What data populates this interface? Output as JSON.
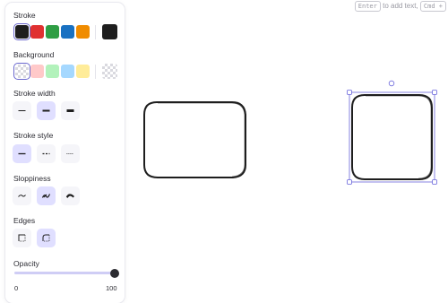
{
  "hint": {
    "enter_key": "Enter",
    "text": "to add text,",
    "cmd_key": "Cmd +"
  },
  "panel": {
    "stroke": {
      "title": "Stroke",
      "colors": [
        "#1e1e1e",
        "#e03131",
        "#2f9e44",
        "#1971c2",
        "#f08c00"
      ],
      "selected_color": "#1e1e1e",
      "current_color": "#1e1e1e"
    },
    "background": {
      "title": "Background",
      "colors": [
        "transparent",
        "#ffc9c9",
        "#b2f2bb",
        "#a5d8ff",
        "#ffec99"
      ],
      "selected_color": "transparent",
      "current_color": "transparent"
    },
    "stroke_width": {
      "title": "Stroke width",
      "options": [
        "thin",
        "bold",
        "extra-bold"
      ],
      "selected": "bold"
    },
    "stroke_style": {
      "title": "Stroke style",
      "options": [
        "solid",
        "dashed",
        "dotted"
      ],
      "selected": "solid"
    },
    "sloppiness": {
      "title": "Sloppiness",
      "options": [
        "architect",
        "artist",
        "cartoonist"
      ],
      "selected": "artist"
    },
    "edges": {
      "title": "Edges",
      "options": [
        "sharp",
        "round"
      ],
      "selected": "round"
    },
    "opacity": {
      "title": "Opacity",
      "min_label": "0",
      "max_label": "100",
      "value": 100
    }
  },
  "canvas": {
    "shapes": [
      {
        "type": "rounded-rectangle",
        "stroke": "#1e1e1e",
        "selected": false
      },
      {
        "type": "rounded-rectangle",
        "stroke": "#1e1e1e",
        "selected": true
      }
    ],
    "selection_color": "#6965db"
  }
}
